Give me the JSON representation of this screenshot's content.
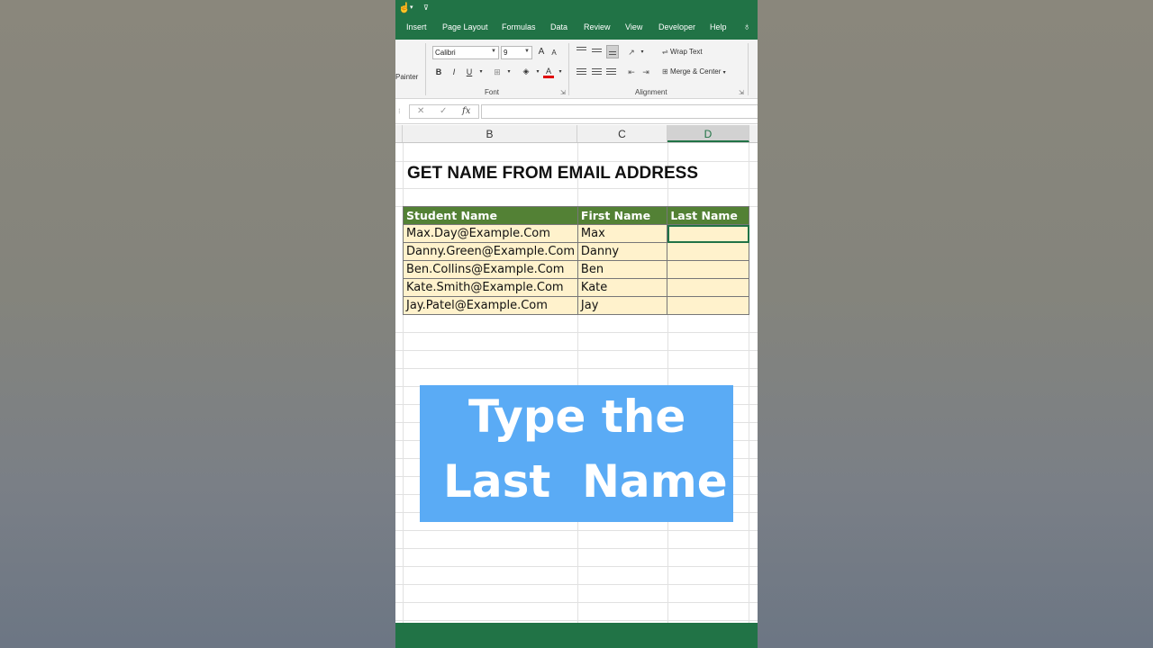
{
  "ribbon": {
    "tabs": [
      "Insert",
      "Page Layout",
      "Formulas",
      "Data",
      "Review",
      "View",
      "Developer",
      "Help"
    ],
    "clipboard_painter_label": "Painter",
    "font_name": "Calibri",
    "font_size": "9",
    "bold": "B",
    "italic": "I",
    "underline": "U",
    "font_color_glyph": "A",
    "font_group_label": "Font",
    "wrap_text": "Wrap Text",
    "merge_center": "Merge & Center",
    "alignment_group_label": "Alignment",
    "accent_color": "#217346"
  },
  "formula_bar": {
    "cancel": "✕",
    "enter": "✓",
    "fx": "fx",
    "value": ""
  },
  "columns": [
    "B",
    "C",
    "D"
  ],
  "sheet": {
    "title": "GET NAME FROM EMAIL ADDRESS",
    "headers": [
      "Student Name",
      "First Name",
      "Last Name"
    ],
    "rows": [
      [
        "Max.Day@Example.Com",
        "Max",
        ""
      ],
      [
        "Danny.Green@Example.Com",
        "Danny",
        ""
      ],
      [
        "Ben.Collins@Example.Com",
        "Ben",
        ""
      ],
      [
        "Kate.Smith@Example.Com",
        "Kate",
        ""
      ],
      [
        "Jay.Patel@Example.Com",
        "Jay",
        ""
      ]
    ],
    "header_color": "#538135",
    "cell_color": "#fff2cc"
  },
  "caption": {
    "line1": "Type the",
    "line2": "Last  Name",
    "color": "#5aabf5"
  }
}
